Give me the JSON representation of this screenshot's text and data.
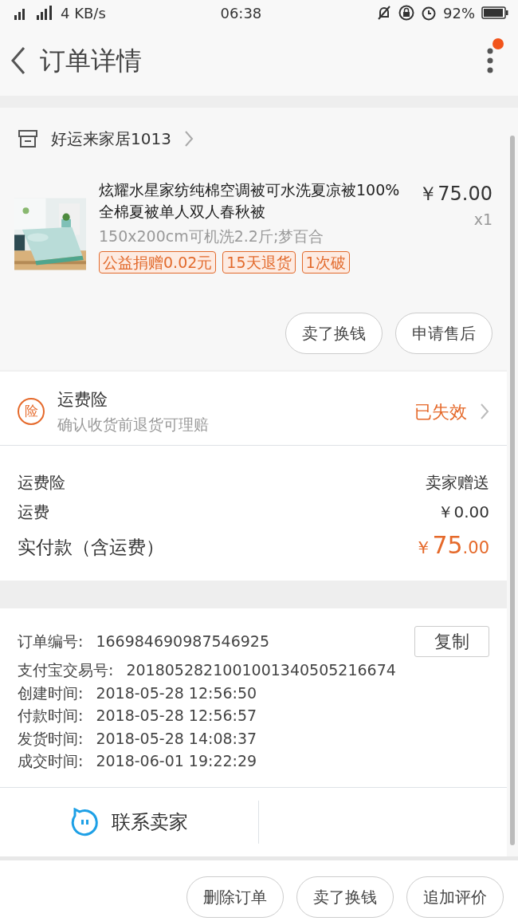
{
  "status_bar": {
    "speed": "4 KB/s",
    "time": "06:38",
    "battery": "92%"
  },
  "header": {
    "title": "订单详情",
    "has_notification": true
  },
  "shop": {
    "name": "好运来家居1013"
  },
  "item": {
    "kind": "picture",
    "title": "炫耀水星家纺纯棉空调被可水洗夏凉被100%全棉夏被单人双人春秋被",
    "price": "￥75.00",
    "quantity": "x1",
    "sku": "150x200cm可机洗2.2斤;梦百合",
    "tags": [
      "公益捐赠0.02元",
      "15天退货",
      "1次破"
    ],
    "actions": [
      "卖了换钱",
      "申请售后"
    ]
  },
  "insurance": {
    "icon_text": "险",
    "title": "运费险",
    "subtitle": "确认收货前退货可理赔",
    "status": "已失效"
  },
  "fees": [
    {
      "label": "运费险",
      "value": "卖家赠送"
    },
    {
      "label": "运费",
      "value": "￥0.00"
    }
  ],
  "total": {
    "label": "实付款（含运费）",
    "currency": "￥",
    "amount": "75",
    "cents": ".00"
  },
  "order_info": [
    {
      "label": "订单编号:",
      "value": "166984690987546925"
    },
    {
      "label": "支付宝交易号:",
      "value": "2018052821001001340505216674"
    },
    {
      "label": "创建时间:",
      "value": "2018-05-28 12:56:50"
    },
    {
      "label": "付款时间:",
      "value": "2018-05-28 12:56:57"
    },
    {
      "label": "发货时间:",
      "value": "2018-05-28 14:08:37"
    },
    {
      "label": "成交时间:",
      "value": "2018-06-01 19:22:29"
    }
  ],
  "copy_button": "复制",
  "contact": "联系卖家",
  "bottom_actions": [
    "删除订单",
    "卖了换钱",
    "追加评价"
  ]
}
